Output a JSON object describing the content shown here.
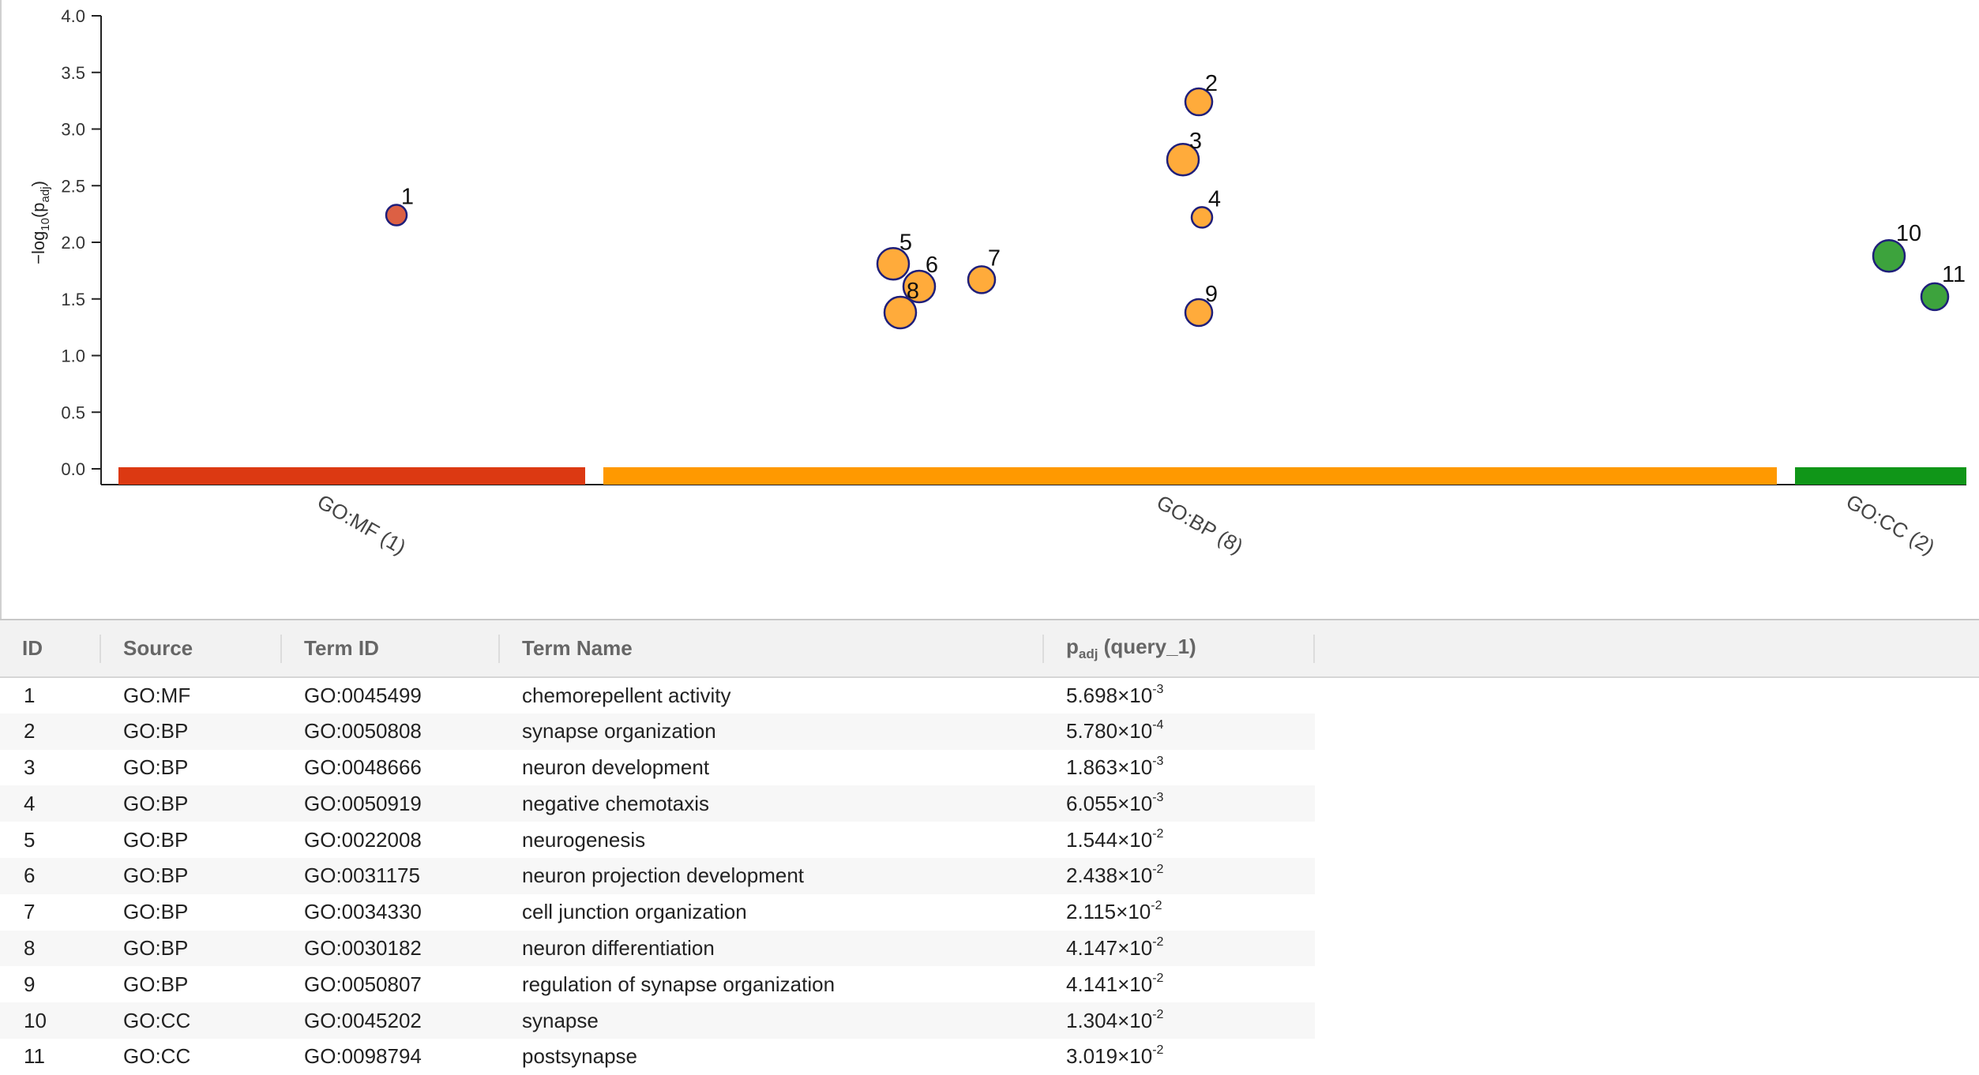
{
  "chart_data": {
    "type": "scatter",
    "ylabel_main": "−log",
    "ylabel_base": "10",
    "ylabel_inner_p": "(p",
    "ylabel_inner_sub": "adj",
    "ylabel_close": ")",
    "ylim": [
      0,
      4.0
    ],
    "yticks": [
      "0.0",
      "0.5",
      "1.0",
      "1.5",
      "2.0",
      "2.5",
      "3.0",
      "3.5",
      "4.0"
    ],
    "grid": false,
    "categories": [
      {
        "id": "mf",
        "label": "GO:MF (1)",
        "color": "#dc3912"
      },
      {
        "id": "bp",
        "label": "GO:BP (8)",
        "color": "#ff9900"
      },
      {
        "id": "cc",
        "label": "GO:CC (2)",
        "color": "#109618"
      }
    ],
    "points": [
      {
        "id": "1",
        "source": "GO:MF",
        "neglog10p": 2.24,
        "color": "#dc6044",
        "size": "small"
      },
      {
        "id": "2",
        "source": "GO:BP",
        "neglog10p": 3.24,
        "color": "#ffab3b",
        "size": "medium"
      },
      {
        "id": "3",
        "source": "GO:BP",
        "neglog10p": 2.73,
        "color": "#ffab3b",
        "size": "large"
      },
      {
        "id": "4",
        "source": "GO:BP",
        "neglog10p": 2.22,
        "color": "#ffab3b",
        "size": "small"
      },
      {
        "id": "5",
        "source": "GO:BP",
        "neglog10p": 1.81,
        "color": "#ffab3b",
        "size": "large"
      },
      {
        "id": "6",
        "source": "GO:BP",
        "neglog10p": 1.61,
        "color": "#ffab3b",
        "size": "large"
      },
      {
        "id": "7",
        "source": "GO:BP",
        "neglog10p": 1.67,
        "color": "#ffab3b",
        "size": "medium"
      },
      {
        "id": "8",
        "source": "GO:BP",
        "neglog10p": 1.38,
        "color": "#ffab3b",
        "size": "large"
      },
      {
        "id": "9",
        "source": "GO:BP",
        "neglog10p": 1.38,
        "color": "#ffab3b",
        "size": "medium"
      },
      {
        "id": "10",
        "source": "GO:CC",
        "neglog10p": 1.88,
        "color": "#3da33d",
        "size": "large"
      },
      {
        "id": "11",
        "source": "GO:CC",
        "neglog10p": 1.52,
        "color": "#3da33d",
        "size": "medium"
      }
    ]
  },
  "table": {
    "headers": {
      "id": "ID",
      "source": "Source",
      "term_id": "Term ID",
      "term_name": "Term Name",
      "padj_p": "p",
      "padj_sub": "adj",
      "padj_query": " (query_1)"
    },
    "rows": [
      {
        "id": "1",
        "source": "GO:MF",
        "term_id": "GO:0045499",
        "term_name": "chemorepellent activity",
        "mantissa": "5.698",
        "times": "×10",
        "exp": "-3"
      },
      {
        "id": "2",
        "source": "GO:BP",
        "term_id": "GO:0050808",
        "term_name": "synapse organization",
        "mantissa": "5.780",
        "times": "×10",
        "exp": "-4"
      },
      {
        "id": "3",
        "source": "GO:BP",
        "term_id": "GO:0048666",
        "term_name": "neuron development",
        "mantissa": "1.863",
        "times": "×10",
        "exp": "-3"
      },
      {
        "id": "4",
        "source": "GO:BP",
        "term_id": "GO:0050919",
        "term_name": "negative chemotaxis",
        "mantissa": "6.055",
        "times": "×10",
        "exp": "-3"
      },
      {
        "id": "5",
        "source": "GO:BP",
        "term_id": "GO:0022008",
        "term_name": "neurogenesis",
        "mantissa": "1.544",
        "times": "×10",
        "exp": "-2"
      },
      {
        "id": "6",
        "source": "GO:BP",
        "term_id": "GO:0031175",
        "term_name": "neuron projection development",
        "mantissa": "2.438",
        "times": "×10",
        "exp": "-2"
      },
      {
        "id": "7",
        "source": "GO:BP",
        "term_id": "GO:0034330",
        "term_name": "cell junction organization",
        "mantissa": "2.115",
        "times": "×10",
        "exp": "-2"
      },
      {
        "id": "8",
        "source": "GO:BP",
        "term_id": "GO:0030182",
        "term_name": "neuron differentiation",
        "mantissa": "4.147",
        "times": "×10",
        "exp": "-2"
      },
      {
        "id": "9",
        "source": "GO:BP",
        "term_id": "GO:0050807",
        "term_name": "regulation of synapse organization",
        "mantissa": "4.141",
        "times": "×10",
        "exp": "-2"
      },
      {
        "id": "10",
        "source": "GO:CC",
        "term_id": "GO:0045202",
        "term_name": "synapse",
        "mantissa": "1.304",
        "times": "×10",
        "exp": "-2"
      },
      {
        "id": "11",
        "source": "GO:CC",
        "term_id": "GO:0098794",
        "term_name": "postsynapse",
        "mantissa": "3.019",
        "times": "×10",
        "exp": "-2"
      }
    ]
  }
}
